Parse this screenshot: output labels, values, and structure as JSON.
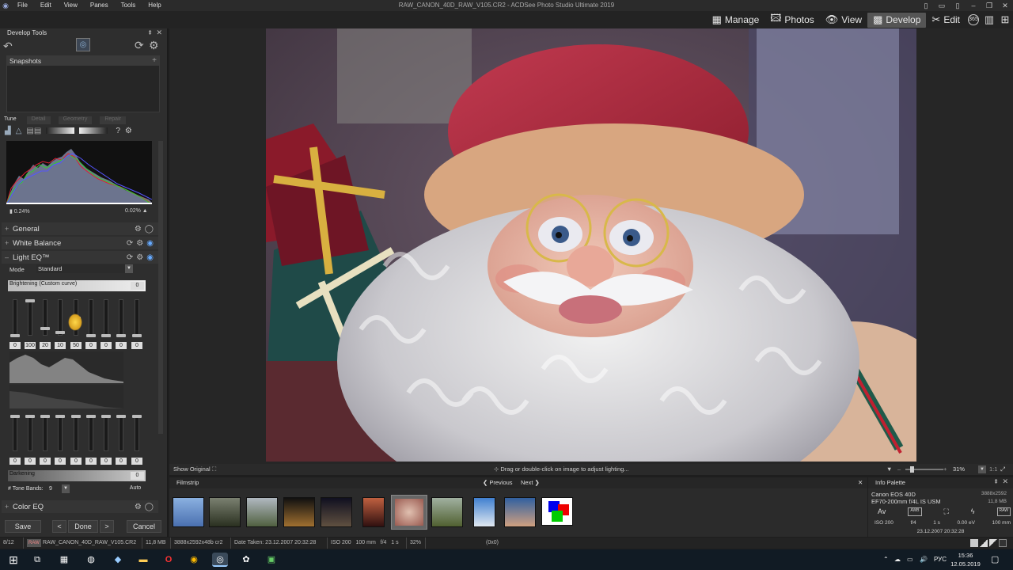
{
  "app": {
    "window_title": "RAW_CANON_40D_RAW_V105.CR2 - ACDSee Photo Studio Ultimate 2019",
    "menu": [
      "File",
      "Edit",
      "View",
      "Panes",
      "Tools",
      "Help"
    ]
  },
  "modes": [
    {
      "label": "Manage",
      "icon": "grid-icon"
    },
    {
      "label": "Photos",
      "icon": "photos-icon"
    },
    {
      "label": "View",
      "icon": "eye-icon"
    },
    {
      "label": "Develop",
      "icon": "develop-icon",
      "active": true
    },
    {
      "label": "Edit",
      "icon": "edit-icon"
    }
  ],
  "mode_extra": {
    "badge": "365"
  },
  "develop_tools": {
    "title": "Develop Tools",
    "snapshots": "Snapshots",
    "tabs": [
      "Tune",
      "Detail",
      "Geometry",
      "Repair"
    ],
    "histogram": {
      "left_clip": "0.24%",
      "right_clip": "0.02%"
    },
    "sections": {
      "general": "General",
      "white_balance": "White Balance",
      "light_eq": "Light EQ™",
      "color_eq": "Color EQ"
    },
    "mode_label": "Mode",
    "mode_value": "Standard",
    "brightening_label": "Brightening (Custom curve)",
    "brightening_value": "0",
    "brighten_values": [
      "0",
      "100",
      "20",
      "10",
      "50",
      "0",
      "0",
      "0",
      "0"
    ],
    "darken_values": [
      "0",
      "0",
      "0",
      "0",
      "0",
      "0",
      "0",
      "0",
      "0"
    ],
    "darkening_label": "Darkening",
    "darkening_value": "0",
    "tone_bands_label": "# Tone Bands:",
    "tone_bands_value": "9",
    "auto_label": "Auto"
  },
  "buttons": {
    "save": "Save",
    "done": "Done",
    "cancel": "Cancel",
    "prev": "<",
    "next": ">"
  },
  "image_bar": {
    "show_original": "Show Original",
    "hint": "Drag or double-click on image to adjust lighting...",
    "zoom": "31%",
    "ratio": "1:1"
  },
  "filmstrip": {
    "title": "Filmstrip",
    "previous": "Previous",
    "next": "Next"
  },
  "info_palette": {
    "title": "Info Palette",
    "camera": "Canon EOS 40D",
    "lens": "EF70-200mm f/4L IS USM",
    "dimensions": "3888x2592",
    "size": "11,8 MB",
    "row_labels": [
      "Av",
      "AWB",
      "",
      "",
      "RAW"
    ],
    "iso": "ISO 200",
    "aperture": "f/4",
    "shutter": "1 s",
    "ev": "0.00 eV",
    "focal": "100 mm",
    "datetime": "23.12.2007 20:32:28"
  },
  "status": {
    "index": "8/12",
    "format": "RAW",
    "filename": "RAW_CANON_40D_RAW_V105.CR2",
    "filesize": "11,8 MB",
    "dims": "3888x2592x48b cr2",
    "date": "Date Taken: 23.12.2007 20:32:28",
    "exposure": "ISO 200   100 mm   f/4   1 s",
    "zoom": "32%",
    "coord": "(0x0)"
  },
  "taskbar": {
    "lang": "РУС",
    "time": "15:36",
    "date": "12.05.2019"
  }
}
